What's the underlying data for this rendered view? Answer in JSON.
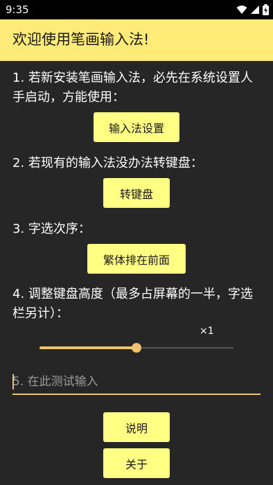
{
  "status_bar": {
    "time": "9:35"
  },
  "app_bar": {
    "title": "欢迎使用笔画输入法!"
  },
  "sections": {
    "s1_text": "1. 若新安装笔画输入法，必先在系统设置人手启动，方能使用：",
    "s1_button": "输入法设置",
    "s2_text": "2. 若现有的输入法没办法转键盘：",
    "s2_button": "转键盘",
    "s3_text": "3. 字选次序：",
    "s3_button": "繁体排在前面",
    "s4_text": "4. 调整键盘高度（最多占屏幕的一半，字选栏另计）：",
    "s4_slider_value_label": "×1",
    "s4_slider_fraction": 0.5
  },
  "test_input": {
    "placeholder": "5. 在此测试输入",
    "value": ""
  },
  "bottom_buttons": {
    "explain": "说明",
    "about": "关于"
  },
  "colors": {
    "accent_yellow": "#ffeb78",
    "button_yellow": "#ffff84",
    "slider_accent": "#f0c46e",
    "background": "#262626"
  }
}
